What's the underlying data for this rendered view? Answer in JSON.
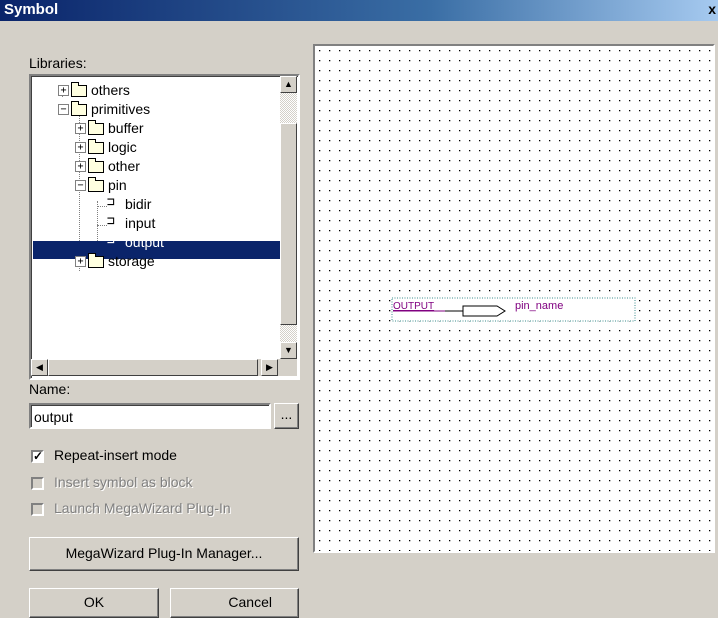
{
  "window": {
    "title": "Symbol",
    "close_glyph": "x"
  },
  "libraries_label": "Libraries:",
  "tree": {
    "items": [
      {
        "label": "others",
        "expanded": false
      },
      {
        "label": "primitives",
        "expanded": true
      },
      {
        "label": "buffer",
        "expanded": false
      },
      {
        "label": "logic",
        "expanded": false
      },
      {
        "label": "other",
        "expanded": false
      },
      {
        "label": "pin",
        "expanded": true
      },
      {
        "label": "bidir"
      },
      {
        "label": "input"
      },
      {
        "label": "output",
        "selected": true
      },
      {
        "label": "storage",
        "expanded": false
      }
    ]
  },
  "name": {
    "label": "Name:",
    "value": "output",
    "browse_label": "..."
  },
  "options": {
    "repeat_insert": {
      "label": "Repeat-insert mode",
      "checked": true
    },
    "insert_as_block": {
      "label": "Insert symbol as block",
      "checked": false
    },
    "launch_megawizard": {
      "label": "Launch MegaWizard Plug-In",
      "checked": false
    }
  },
  "megawizard_button": "MegaWizard Plug-In Manager...",
  "ok_button": "OK",
  "cancel_button": "Cancel",
  "preview": {
    "symbol_type": "OUTPUT",
    "pin_name": "pin_name"
  },
  "icons": [
    "tree-expand-icon",
    "tree-collapse-icon",
    "folder-icon",
    "folder-open-icon",
    "pin-icon",
    "checkmark-icon",
    "scroll-up-icon",
    "scroll-down-icon",
    "scroll-left-icon",
    "scroll-right-icon"
  ]
}
